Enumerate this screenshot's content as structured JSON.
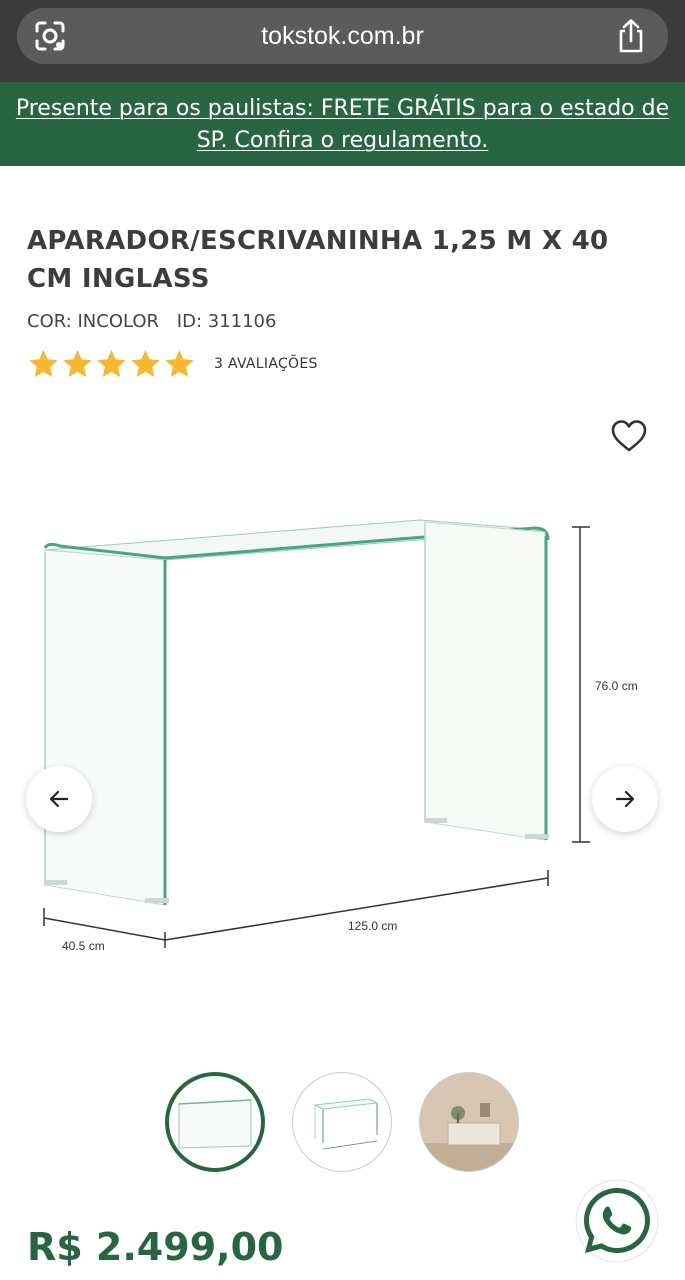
{
  "browser": {
    "url": "tokstok.com.br"
  },
  "promo": {
    "text": "Presente para os paulistas: FRETE GRÁTIS para o estado de SP. Confira o regulamento."
  },
  "product": {
    "title": "APARADOR/ESCRIVANINHA 1,25 M X 40 CM INGLASS",
    "color": "COR: INCOLOR",
    "id": "ID: 311106",
    "rating": 5,
    "reviews": "3 AVALIAÇÕES",
    "price": "R$ 2.499,00",
    "dimensions": {
      "height": "76.0 cm",
      "width": "125.0 cm",
      "depth": "40.5 cm"
    }
  },
  "colors": {
    "brand_green": "#276641",
    "star": "#F5B82E",
    "glass": "#7fbfa6"
  },
  "icons": [
    "lens-icon",
    "share-icon",
    "heart-icon",
    "arrow-left-icon",
    "arrow-right-icon",
    "whatsapp-icon",
    "star-icon"
  ]
}
